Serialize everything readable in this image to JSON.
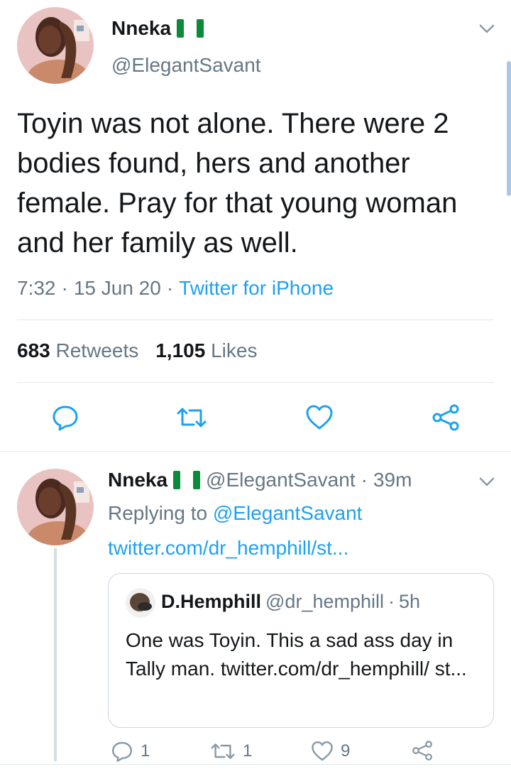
{
  "main_tweet": {
    "name": "Nneka",
    "handle": "@ElegantSavant",
    "text": "Toyin was not alone. There were 2 bodies found, hers and another female. Pray for that young woman and her family as well.",
    "time": "7:32",
    "date": "15 Jun 20",
    "source": "Twitter for iPhone",
    "retweets_count": "683",
    "retweets_label": "Retweets",
    "likes_count": "1,105",
    "likes_label": "Likes",
    "separator": "·"
  },
  "reply_tweet": {
    "name": "Nneka",
    "handle": "@ElegantSavant",
    "separator": "·",
    "age": "39m",
    "replying_prefix": "Replying to",
    "replying_to": "@ElegantSavant",
    "link": "twitter.com/dr_hemphill/st...",
    "quote": {
      "name": "D.Hemphill",
      "handle": "@dr_hemphill",
      "separator": "·",
      "age": "5h",
      "text": "One was Toyin. This a sad ass day in Tally man. twitter.com/dr_hemphill/ st..."
    },
    "actions": {
      "reply_count": "1",
      "retweet_count": "1",
      "like_count": "9"
    }
  },
  "icons": {
    "reply": "reply-icon",
    "retweet": "retweet-icon",
    "like": "heart-icon",
    "share": "share-icon",
    "menu": "chevron-down-icon",
    "flag": "nigeria-flag-icon"
  },
  "colors": {
    "accent": "#1da1f2",
    "muted": "#657786",
    "text": "#14171a",
    "border": "#e1e8ed",
    "flag_green": "#0a8a3a"
  }
}
